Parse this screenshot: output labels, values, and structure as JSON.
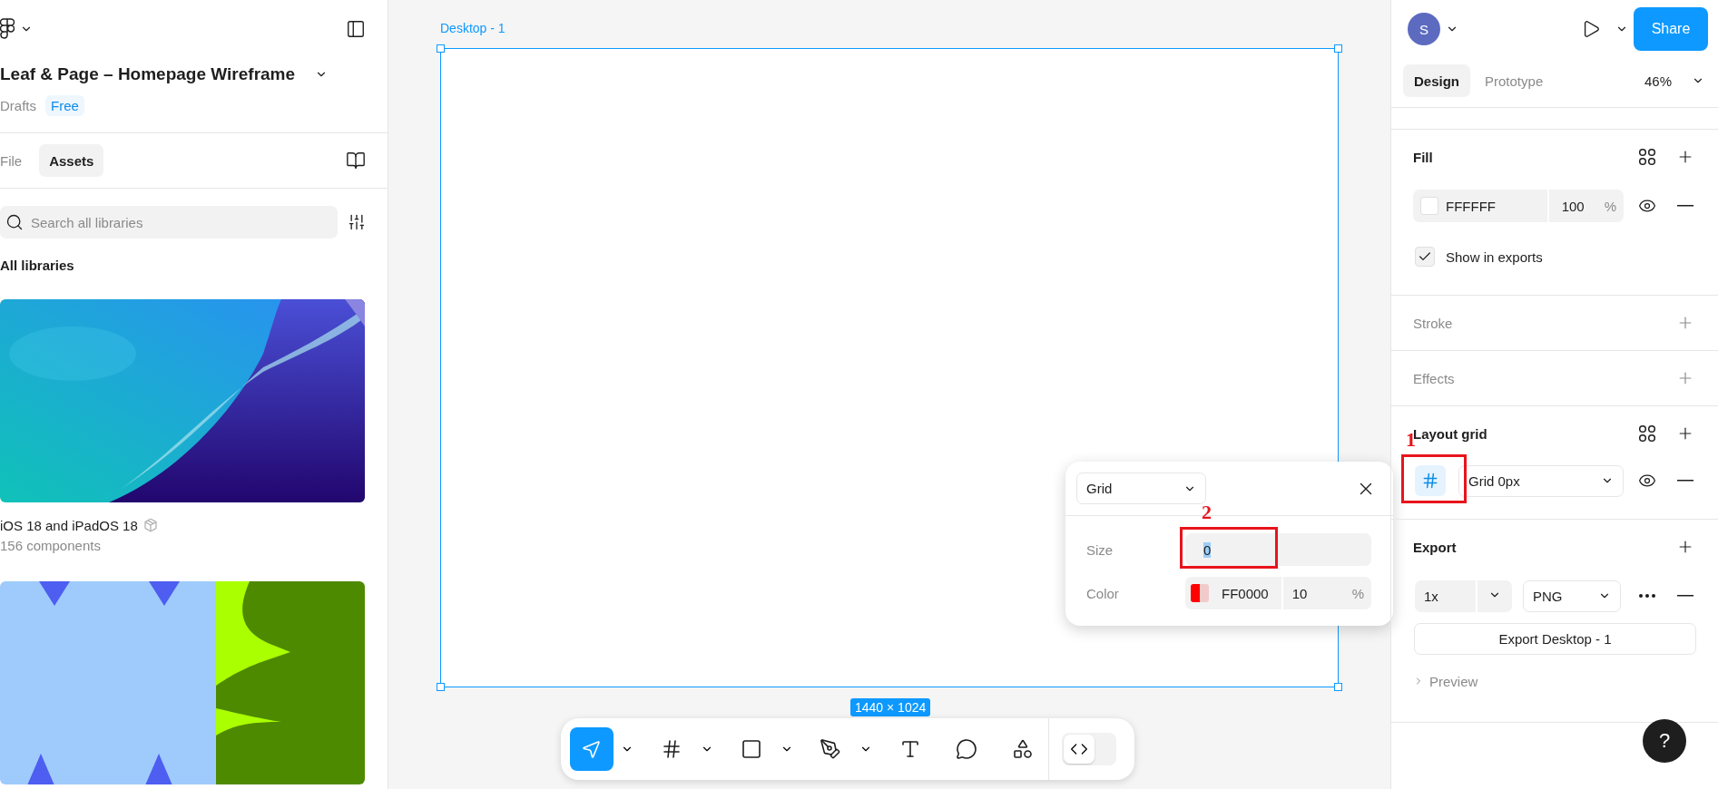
{
  "file": {
    "title": "Leaf & Page – Homepage Wireframe",
    "location": "Drafts",
    "plan": "Free"
  },
  "left_tabs": [
    {
      "label": "File",
      "selected": false
    },
    {
      "label": "Assets",
      "selected": true
    }
  ],
  "search": {
    "placeholder": "Search all libraries"
  },
  "libraries_heading": "All libraries",
  "libraries": [
    {
      "name": "iOS 18 and iPadOS 18",
      "count": "156 components"
    }
  ],
  "canvas": {
    "frame_label": "Desktop - 1",
    "frame_size": "1440 × 1024"
  },
  "grid_popup": {
    "type": "Grid",
    "size": {
      "label": "Size",
      "value": "0",
      "annotation": "2"
    },
    "color": {
      "label": "Color",
      "hex": "FF0000",
      "opacity": "10",
      "unit": "%"
    }
  },
  "toolbar": {
    "tools": [
      {
        "kind": "move",
        "selected": true,
        "menu": true
      },
      {
        "kind": "frame",
        "selected": false,
        "menu": true
      },
      {
        "kind": "rectangle",
        "selected": false,
        "menu": true
      },
      {
        "kind": "pen",
        "selected": false,
        "menu": true
      },
      {
        "kind": "text",
        "selected": false,
        "menu": false
      },
      {
        "kind": "comment",
        "selected": false,
        "menu": false
      },
      {
        "kind": "actions",
        "selected": false,
        "menu": false
      }
    ],
    "dev_mode": {
      "on": false
    }
  },
  "user": {
    "initial": "S"
  },
  "share": "Share",
  "right_tabs": [
    {
      "label": "Design",
      "selected": true
    },
    {
      "label": "Prototype",
      "selected": false
    }
  ],
  "zoom": "46%",
  "fill": {
    "title": "Fill",
    "hex": "FFFFFF",
    "opacity": "100",
    "unit": "%",
    "show_in_exports": {
      "label": "Show in exports",
      "checked": true
    }
  },
  "stroke": {
    "title": "Stroke"
  },
  "effects": {
    "title": "Effects"
  },
  "layout_grid": {
    "title": "Layout grid",
    "grid": "Grid 0px",
    "selected": true,
    "annotation": "1"
  },
  "export": {
    "title": "Export",
    "scale": "1x",
    "format": "PNG",
    "button": "Export Desktop - 1",
    "preview": "Preview",
    "preview_expanded": false
  },
  "help": "?"
}
